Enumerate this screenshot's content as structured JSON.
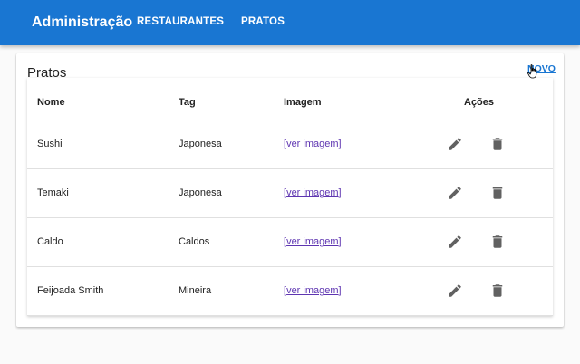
{
  "appbar": {
    "brand": "Administração",
    "nav": [
      "RESTAURANTES",
      "PRATOS"
    ]
  },
  "card": {
    "title": "Pratos",
    "new_label": "NOVO"
  },
  "table": {
    "headers": [
      "Nome",
      "Tag",
      "Imagem",
      "Ações"
    ],
    "rows": [
      {
        "nome": "Sushi",
        "tag": "Japonesa",
        "imagem": "ver imagem"
      },
      {
        "nome": "Temaki",
        "tag": "Japonesa",
        "imagem": "ver imagem"
      },
      {
        "nome": "Caldo",
        "tag": "Caldos",
        "imagem": "ver imagem"
      },
      {
        "nome": "Feijoada Smith",
        "tag": "Mineira",
        "imagem": "ver imagem"
      }
    ],
    "actions": [
      "edit-icon",
      "delete-icon"
    ]
  },
  "colors": {
    "primary": "#1976d2",
    "icon": "#616161",
    "link": "#5e35b1"
  }
}
